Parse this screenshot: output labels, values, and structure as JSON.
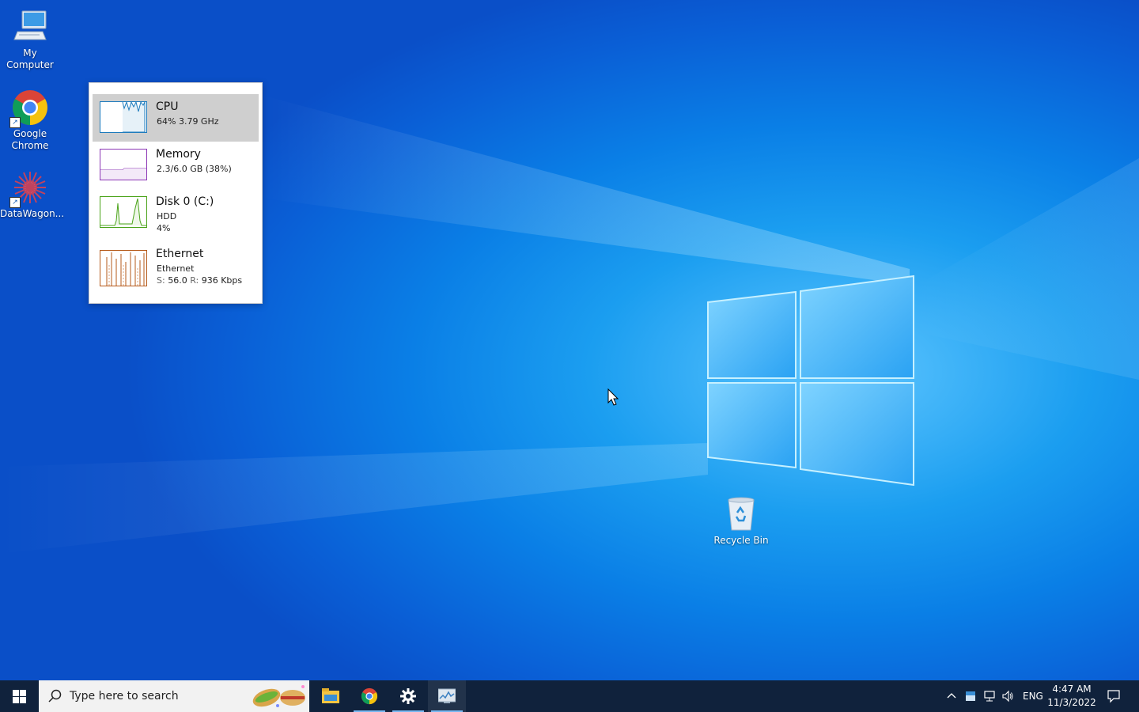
{
  "desktop": {
    "icons": [
      {
        "label": "My\nComputer",
        "icon": "computer-icon"
      },
      {
        "label": "Google\nChrome",
        "icon": "chrome-icon"
      },
      {
        "label": "DataWagon...",
        "icon": "datawagon-icon"
      },
      {
        "label": "Recycle Bin",
        "icon": "recycle-bin-icon"
      }
    ]
  },
  "perf_widget": {
    "items": [
      {
        "title": "CPU",
        "line1": "64%  3.79 GHz",
        "color": "#1d7bbd",
        "selected": true
      },
      {
        "title": "Memory",
        "line1": "2.3/6.0 GB (38%)",
        "color": "#8b35b5"
      },
      {
        "title": "Disk 0 (C:)",
        "line1": "HDD",
        "line2": "4%",
        "color": "#4aa319"
      },
      {
        "title": "Ethernet",
        "line1": "Ethernet",
        "line2_s_label": "S:",
        "line2_s": "56.0",
        "line2_r_label": "R:",
        "line2_r": "936 Kbps",
        "color": "#b65a1a"
      }
    ]
  },
  "taskbar": {
    "search_placeholder": "Type here to search",
    "apps": [
      "file-explorer-icon",
      "chrome-icon",
      "settings-icon",
      "monitor-app-icon"
    ],
    "tray": {
      "lang": "ENG",
      "time": "4:47 AM",
      "date": "11/3/2022"
    }
  },
  "colors": {
    "taskbar_bg": "#10223c",
    "accent_underline": "#77b8f2"
  }
}
